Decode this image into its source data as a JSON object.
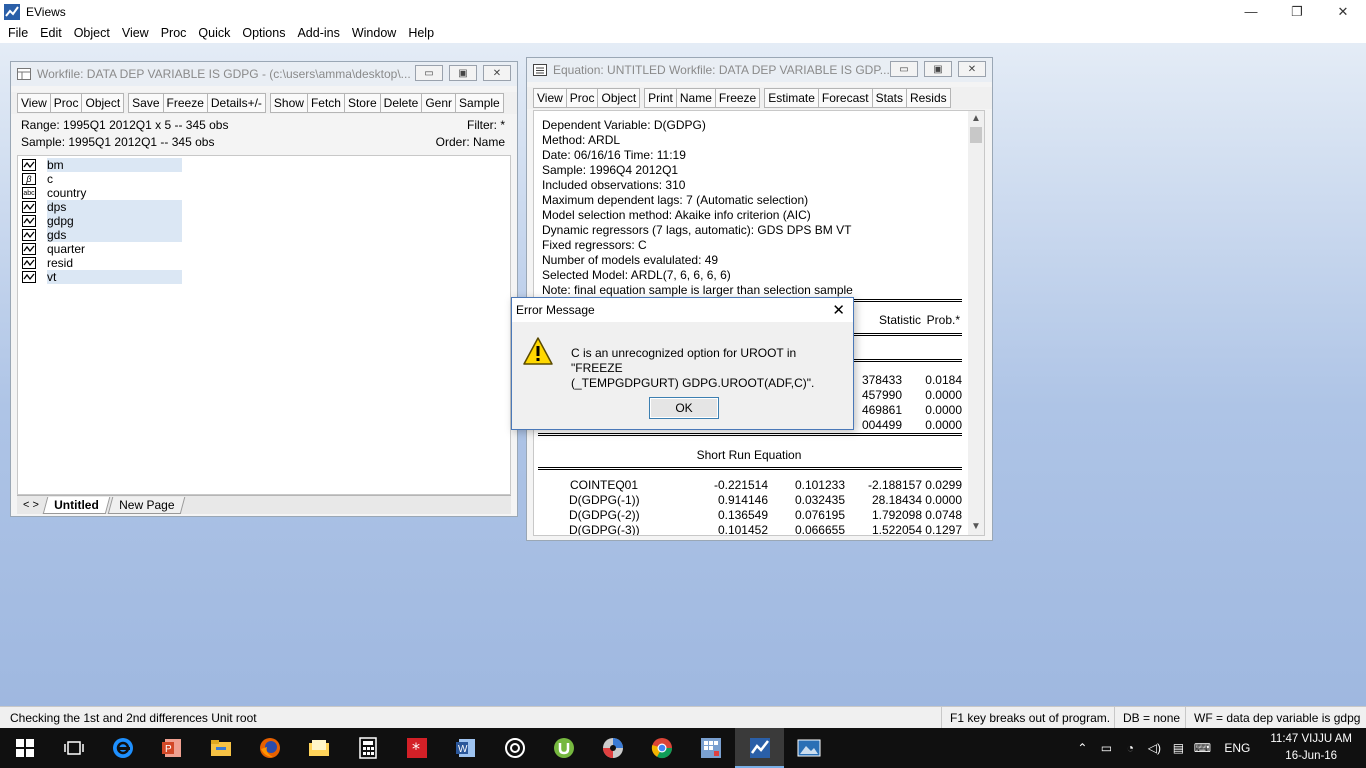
{
  "app": {
    "title": "EViews",
    "window_controls": [
      "—",
      "❐",
      "✕"
    ]
  },
  "menubar": [
    "File",
    "Edit",
    "Object",
    "View",
    "Proc",
    "Quick",
    "Options",
    "Add-ins",
    "Window",
    "Help"
  ],
  "workfile": {
    "title": "Workfile: DATA DEP VARIABLE IS GDPG - (c:\\users\\amma\\desktop\\...",
    "toolbar": [
      "View",
      "Proc",
      "Object",
      "Save",
      "Freeze",
      "Details+/-",
      "Show",
      "Fetch",
      "Store",
      "Delete",
      "Genr",
      "Sample"
    ],
    "range": "Range:  1995Q1 2012Q1 x 5  --  345 obs",
    "sample": "Sample: 1995Q1 2012Q1  --  345 obs",
    "filter": "Filter: *",
    "order": "Order: Name",
    "objects": [
      {
        "name": "bm",
        "icon": "series-icon",
        "glyph": "",
        "selected": true
      },
      {
        "name": "c",
        "icon": "coef-icon",
        "glyph": "β",
        "selected": false
      },
      {
        "name": "country",
        "icon": "alpha-icon",
        "glyph": "abc",
        "selected": false
      },
      {
        "name": "dps",
        "icon": "series-icon",
        "glyph": "",
        "selected": true
      },
      {
        "name": "gdpg",
        "icon": "series-icon",
        "glyph": "",
        "selected": true
      },
      {
        "name": "gds",
        "icon": "series-icon",
        "glyph": "",
        "selected": true
      },
      {
        "name": "quarter",
        "icon": "series-icon",
        "glyph": "",
        "selected": false
      },
      {
        "name": "resid",
        "icon": "series-icon",
        "glyph": "",
        "selected": false
      },
      {
        "name": "vt",
        "icon": "series-icon",
        "glyph": "",
        "selected": true
      }
    ],
    "tabs": [
      "Untitled",
      "New Page"
    ],
    "tab_nav": "< >"
  },
  "equation": {
    "title": "Equation: UNTITLED   Workfile: DATA DEP VARIABLE IS GDP...",
    "toolbar": [
      "View",
      "Proc",
      "Object",
      "Print",
      "Name",
      "Freeze",
      "Estimate",
      "Forecast",
      "Stats",
      "Resids"
    ],
    "header_lines": [
      "Dependent Variable: D(GDPG)",
      "Method: ARDL",
      "Date: 06/16/16   Time: 11:19",
      "Sample: 1996Q4 2012Q1",
      "Included observations: 310",
      "Maximum dependent lags: 7 (Automatic selection)",
      "Model selection method: Akaike info criterion (AIC)",
      "Dynamic regressors (7 lags, automatic): GDS DPS BM VT",
      "Fixed regressors: C",
      "Number of models evalulated: 49",
      "Selected Model: ARDL(7, 6, 6, 6, 6)",
      "Note: final equation sample is larger than selection sample"
    ],
    "col_headers": {
      "stat": "Statistic",
      "prob": "Prob.*"
    },
    "partial_rows": [
      {
        "stat": "378433",
        "prob": "0.0184"
      },
      {
        "stat": "457990",
        "prob": "0.0000"
      },
      {
        "stat": "469861",
        "prob": "0.0000"
      },
      {
        "stat": "004499",
        "prob": "0.0000"
      }
    ],
    "section_title": "Short Run Equation",
    "rows": [
      {
        "var": "COINTEQ01",
        "coef": "-0.221514",
        "se": "0.101233",
        "t": "-2.188157",
        "p": "0.0299"
      },
      {
        "var": "D(GDPG(-1))",
        "coef": "0.914146",
        "se": "0.032435",
        "t": "28.18434",
        "p": "0.0000"
      },
      {
        "var": "D(GDPG(-2))",
        "coef": "0.136549",
        "se": "0.076195",
        "t": "1.792098",
        "p": "0.0748"
      },
      {
        "var": "D(GDPG(-3))",
        "coef": "0.101452",
        "se": "0.066655",
        "t": "1.522054",
        "p": "0.1297"
      }
    ]
  },
  "dialog": {
    "title": "Error Message",
    "message_line1": "C is an unrecognized option for UROOT in \"FREEZE",
    "message_line2": "(_TEMPGDPGURT) GDPG.UROOT(ADF,C)\".",
    "ok_label": "OK"
  },
  "statusbar": {
    "message": "Checking the 1st and 2nd differences Unit root",
    "f1": "F1 key breaks out of program.",
    "db": "DB = none",
    "wf": "WF = data dep variable is gdpg"
  },
  "taskbar": {
    "apps": [
      "start-icon",
      "task-view-icon",
      "edge-icon",
      "powerpoint-icon",
      "file-explorer-icon",
      "firefox-icon",
      "folder-icon",
      "calculator-icon",
      "red-app-icon",
      "word-icon",
      "circle-app-icon",
      "utorrent-icon",
      "media-icon",
      "chrome-icon",
      "grid-app-icon",
      "eviews-taskbar-icon",
      "photos-icon"
    ],
    "lang": "ENG",
    "time": "11:47 VIJJU AM",
    "date": "16-Jun-16"
  },
  "colors": {
    "desktop_top": "#e4ecf6",
    "desktop_bottom": "#9fb8e0",
    "taskbar": "#101010",
    "selection": "#dbe7f4"
  }
}
